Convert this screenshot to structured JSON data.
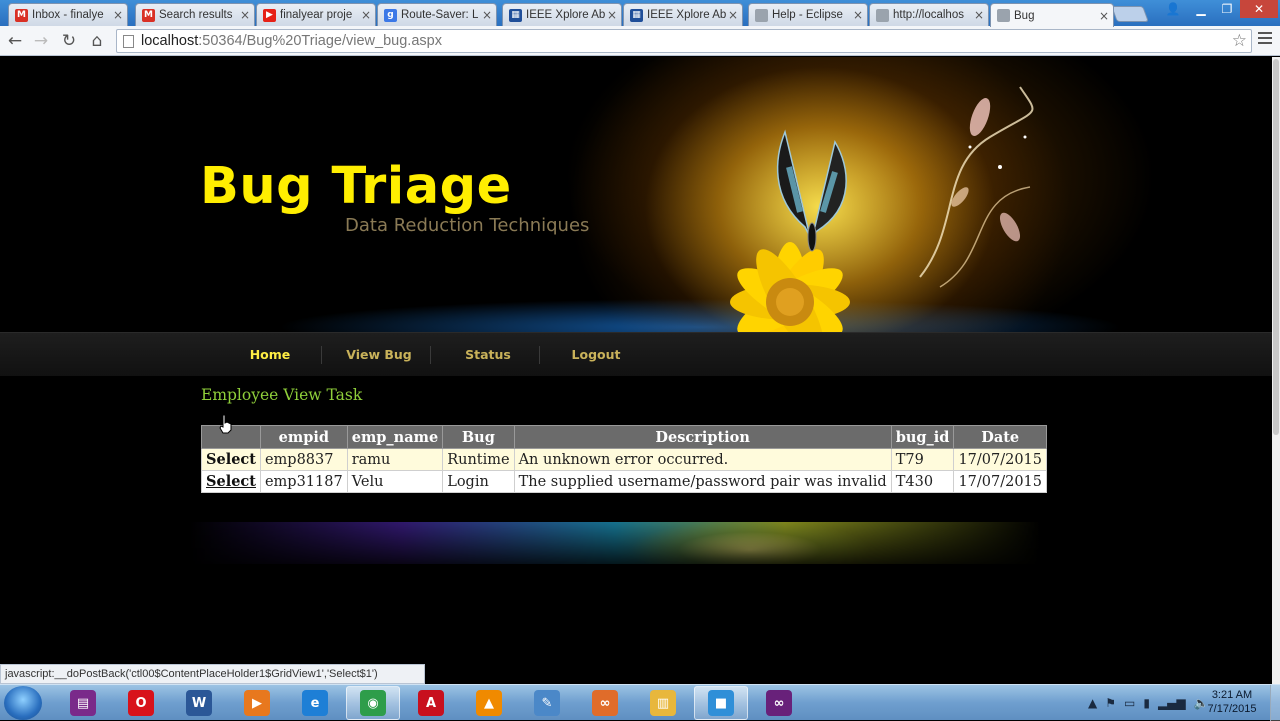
{
  "browser": {
    "tabs": [
      {
        "title": "Inbox - finalye",
        "favicon": "gmail-icon",
        "color": "#d93025",
        "glyph": "M"
      },
      {
        "title": "Search results",
        "favicon": "gmail-icon",
        "color": "#d93025",
        "glyph": "M"
      },
      {
        "title": "finalyear proje",
        "favicon": "youtube-icon",
        "color": "#e62117",
        "glyph": "▶"
      },
      {
        "title": "Route-Saver: L",
        "favicon": "google-icon",
        "color": "#3b78e7",
        "glyph": "g"
      },
      {
        "title": "IEEE Xplore Ab",
        "favicon": "ieee-icon",
        "color": "#1f4e99",
        "glyph": "▦"
      },
      {
        "title": "IEEE Xplore Ab",
        "favicon": "ieee-icon",
        "color": "#1f4e99",
        "glyph": "▦"
      },
      {
        "title": "Help - Eclipse",
        "favicon": "page-icon",
        "color": "#9aa3ad",
        "glyph": ""
      },
      {
        "title": "http://localhos",
        "favicon": "page-icon",
        "color": "#9aa3ad",
        "glyph": ""
      },
      {
        "title": "Bug",
        "favicon": "page-icon",
        "color": "#9aa3ad",
        "glyph": ""
      }
    ],
    "tab_close_glyph": "×",
    "url_host": "localhost",
    "url_path": ":50364/Bug%20Triage/view_bug.aspx",
    "status_text": "javascript:__doPostBack('ctl00$ContentPlaceHolder1$GridView1','Select$1')"
  },
  "site": {
    "title": "Bug Triage",
    "subtitle": "Data Reduction Techniques",
    "nav": [
      "Home",
      "View Bug",
      "Status",
      "Logout"
    ]
  },
  "content": {
    "section_title": "Employee View Task",
    "table": {
      "headers": [
        "",
        "empid",
        "emp_name",
        "Bug",
        "Description",
        "bug_id",
        "Date"
      ],
      "rows": [
        [
          "Select",
          "emp8837",
          "ramu",
          "Runtime",
          "An unknown error occurred.",
          "T79",
          "17/07/2015"
        ],
        [
          "Select",
          "emp31187",
          "Velu",
          "Login",
          "The supplied username/password pair was invalid",
          "T430",
          "17/07/2015"
        ]
      ]
    }
  },
  "taskbar": {
    "clock_time": "3:21 AM",
    "clock_date": "7/17/2015",
    "apps": [
      {
        "name": "winrar-icon",
        "color": "#7a2a8a",
        "glyph": "▤"
      },
      {
        "name": "opera-icon",
        "color": "#d8121b",
        "glyph": "O"
      },
      {
        "name": "word-icon",
        "color": "#2b5797",
        "glyph": "W"
      },
      {
        "name": "media-player-icon",
        "color": "#e8781e",
        "glyph": "▶"
      },
      {
        "name": "internet-explorer-icon",
        "color": "#1e7fd6",
        "glyph": "e"
      },
      {
        "name": "chrome-icon",
        "color": "#2e9d4a",
        "glyph": "◉"
      },
      {
        "name": "acrobat-icon",
        "color": "#c8101e",
        "glyph": "A"
      },
      {
        "name": "vlc-icon",
        "color": "#f08a00",
        "glyph": "▲"
      },
      {
        "name": "paint-icon",
        "color": "#4b88c8",
        "glyph": "✎"
      },
      {
        "name": "visual-studio-icon",
        "color": "#e06c2a",
        "glyph": "∞"
      },
      {
        "name": "file-explorer-icon",
        "color": "#e8b73c",
        "glyph": "▥"
      },
      {
        "name": "camtasia-icon",
        "color": "#2f8fd8",
        "glyph": "■"
      },
      {
        "name": "visual-studio-purple-icon",
        "color": "#68217a",
        "glyph": "∞"
      }
    ]
  }
}
